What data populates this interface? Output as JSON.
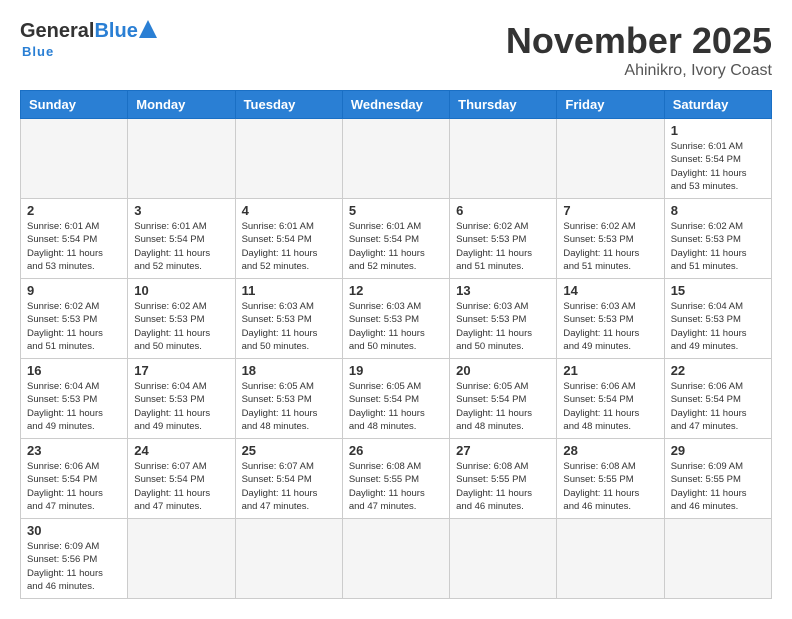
{
  "header": {
    "logo_general": "General",
    "logo_blue": "Blue",
    "logo_subtext": "Blue",
    "month_title": "November 2025",
    "location": "Ahinikro, Ivory Coast"
  },
  "calendar": {
    "days_of_week": [
      "Sunday",
      "Monday",
      "Tuesday",
      "Wednesday",
      "Thursday",
      "Friday",
      "Saturday"
    ],
    "weeks": [
      [
        {
          "day": "",
          "info": ""
        },
        {
          "day": "",
          "info": ""
        },
        {
          "day": "",
          "info": ""
        },
        {
          "day": "",
          "info": ""
        },
        {
          "day": "",
          "info": ""
        },
        {
          "day": "",
          "info": ""
        },
        {
          "day": "1",
          "info": "Sunrise: 6:01 AM\nSunset: 5:54 PM\nDaylight: 11 hours\nand 53 minutes."
        }
      ],
      [
        {
          "day": "2",
          "info": "Sunrise: 6:01 AM\nSunset: 5:54 PM\nDaylight: 11 hours\nand 53 minutes."
        },
        {
          "day": "3",
          "info": "Sunrise: 6:01 AM\nSunset: 5:54 PM\nDaylight: 11 hours\nand 52 minutes."
        },
        {
          "day": "4",
          "info": "Sunrise: 6:01 AM\nSunset: 5:54 PM\nDaylight: 11 hours\nand 52 minutes."
        },
        {
          "day": "5",
          "info": "Sunrise: 6:01 AM\nSunset: 5:54 PM\nDaylight: 11 hours\nand 52 minutes."
        },
        {
          "day": "6",
          "info": "Sunrise: 6:02 AM\nSunset: 5:53 PM\nDaylight: 11 hours\nand 51 minutes."
        },
        {
          "day": "7",
          "info": "Sunrise: 6:02 AM\nSunset: 5:53 PM\nDaylight: 11 hours\nand 51 minutes."
        },
        {
          "day": "8",
          "info": "Sunrise: 6:02 AM\nSunset: 5:53 PM\nDaylight: 11 hours\nand 51 minutes."
        }
      ],
      [
        {
          "day": "9",
          "info": "Sunrise: 6:02 AM\nSunset: 5:53 PM\nDaylight: 11 hours\nand 51 minutes."
        },
        {
          "day": "10",
          "info": "Sunrise: 6:02 AM\nSunset: 5:53 PM\nDaylight: 11 hours\nand 50 minutes."
        },
        {
          "day": "11",
          "info": "Sunrise: 6:03 AM\nSunset: 5:53 PM\nDaylight: 11 hours\nand 50 minutes."
        },
        {
          "day": "12",
          "info": "Sunrise: 6:03 AM\nSunset: 5:53 PM\nDaylight: 11 hours\nand 50 minutes."
        },
        {
          "day": "13",
          "info": "Sunrise: 6:03 AM\nSunset: 5:53 PM\nDaylight: 11 hours\nand 50 minutes."
        },
        {
          "day": "14",
          "info": "Sunrise: 6:03 AM\nSunset: 5:53 PM\nDaylight: 11 hours\nand 49 minutes."
        },
        {
          "day": "15",
          "info": "Sunrise: 6:04 AM\nSunset: 5:53 PM\nDaylight: 11 hours\nand 49 minutes."
        }
      ],
      [
        {
          "day": "16",
          "info": "Sunrise: 6:04 AM\nSunset: 5:53 PM\nDaylight: 11 hours\nand 49 minutes."
        },
        {
          "day": "17",
          "info": "Sunrise: 6:04 AM\nSunset: 5:53 PM\nDaylight: 11 hours\nand 49 minutes."
        },
        {
          "day": "18",
          "info": "Sunrise: 6:05 AM\nSunset: 5:53 PM\nDaylight: 11 hours\nand 48 minutes."
        },
        {
          "day": "19",
          "info": "Sunrise: 6:05 AM\nSunset: 5:54 PM\nDaylight: 11 hours\nand 48 minutes."
        },
        {
          "day": "20",
          "info": "Sunrise: 6:05 AM\nSunset: 5:54 PM\nDaylight: 11 hours\nand 48 minutes."
        },
        {
          "day": "21",
          "info": "Sunrise: 6:06 AM\nSunset: 5:54 PM\nDaylight: 11 hours\nand 48 minutes."
        },
        {
          "day": "22",
          "info": "Sunrise: 6:06 AM\nSunset: 5:54 PM\nDaylight: 11 hours\nand 47 minutes."
        }
      ],
      [
        {
          "day": "23",
          "info": "Sunrise: 6:06 AM\nSunset: 5:54 PM\nDaylight: 11 hours\nand 47 minutes."
        },
        {
          "day": "24",
          "info": "Sunrise: 6:07 AM\nSunset: 5:54 PM\nDaylight: 11 hours\nand 47 minutes."
        },
        {
          "day": "25",
          "info": "Sunrise: 6:07 AM\nSunset: 5:54 PM\nDaylight: 11 hours\nand 47 minutes."
        },
        {
          "day": "26",
          "info": "Sunrise: 6:08 AM\nSunset: 5:55 PM\nDaylight: 11 hours\nand 47 minutes."
        },
        {
          "day": "27",
          "info": "Sunrise: 6:08 AM\nSunset: 5:55 PM\nDaylight: 11 hours\nand 46 minutes."
        },
        {
          "day": "28",
          "info": "Sunrise: 6:08 AM\nSunset: 5:55 PM\nDaylight: 11 hours\nand 46 minutes."
        },
        {
          "day": "29",
          "info": "Sunrise: 6:09 AM\nSunset: 5:55 PM\nDaylight: 11 hours\nand 46 minutes."
        }
      ],
      [
        {
          "day": "30",
          "info": "Sunrise: 6:09 AM\nSunset: 5:56 PM\nDaylight: 11 hours\nand 46 minutes."
        },
        {
          "day": "",
          "info": ""
        },
        {
          "day": "",
          "info": ""
        },
        {
          "day": "",
          "info": ""
        },
        {
          "day": "",
          "info": ""
        },
        {
          "day": "",
          "info": ""
        },
        {
          "day": "",
          "info": ""
        }
      ]
    ]
  }
}
